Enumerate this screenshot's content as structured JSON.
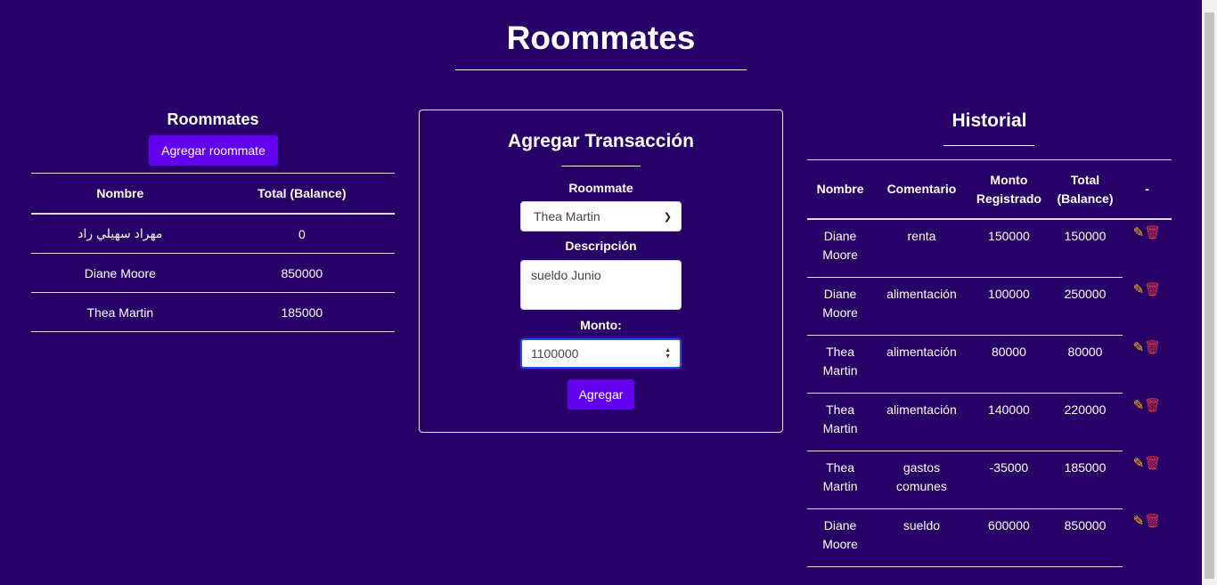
{
  "page": {
    "title": "Roommates"
  },
  "roommates_panel": {
    "heading": "Roommates",
    "add_button": "Agregar roommate",
    "columns": [
      "Nombre",
      "Total (Balance)"
    ],
    "rows": [
      {
        "name": "مهراد سهيلي راد",
        "balance": "0"
      },
      {
        "name": "Diane Moore",
        "balance": "850000"
      },
      {
        "name": "Thea Martin",
        "balance": "185000"
      }
    ]
  },
  "transaction_form": {
    "heading": "Agregar Transacción",
    "roommate_label": "Roommate",
    "roommate_selected": "Thea Martin",
    "description_label": "Descripción",
    "description_value": "sueldo Junio",
    "amount_label": "Monto:",
    "amount_value": "1100000",
    "submit_label": "Agregar"
  },
  "history": {
    "heading": "Historial",
    "columns": [
      "Nombre",
      "Comentario",
      "Monto Registrado",
      "Total (Balance)",
      "-"
    ],
    "rows": [
      {
        "name": "Diane Moore",
        "comment": "renta",
        "amount": "150000",
        "total": "150000"
      },
      {
        "name": "Diane Moore",
        "comment": "alimentación",
        "amount": "100000",
        "total": "250000"
      },
      {
        "name": "Thea Martin",
        "comment": "alimentación",
        "amount": "80000",
        "total": "80000"
      },
      {
        "name": "Thea Martin",
        "comment": "alimentación",
        "amount": "140000",
        "total": "220000"
      },
      {
        "name": "Thea Martin",
        "comment": "gastos comunes",
        "amount": "-35000",
        "total": "185000"
      },
      {
        "name": "Diane Moore",
        "comment": "sueldo",
        "amount": "600000",
        "total": "850000"
      }
    ]
  },
  "icons": {
    "edit": "edit-icon",
    "delete": "trash-icon"
  },
  "colors": {
    "background": "#260066",
    "accent": "#6200ee",
    "edit": "#ffc107",
    "delete": "#dc3545"
  }
}
